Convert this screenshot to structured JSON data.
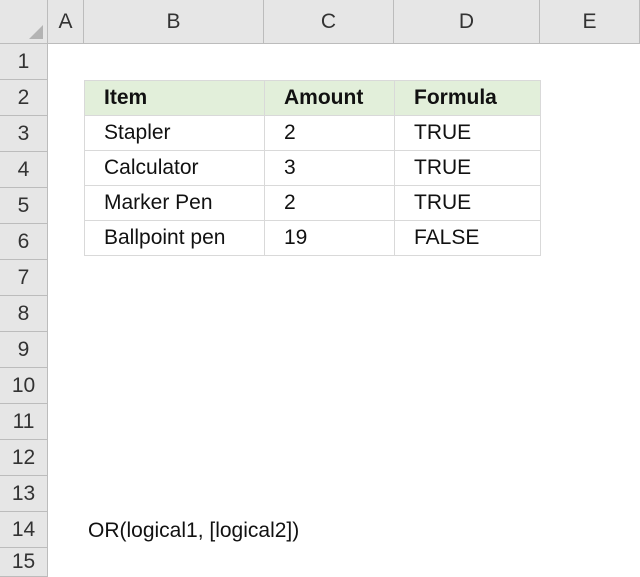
{
  "columns": [
    "A",
    "B",
    "C",
    "D",
    "E"
  ],
  "rows": [
    "1",
    "2",
    "3",
    "4",
    "5",
    "6",
    "7",
    "8",
    "9",
    "10",
    "11",
    "12",
    "13",
    "14",
    "15"
  ],
  "table": {
    "headers": [
      "Item",
      "Amount",
      "Formula"
    ],
    "rows": [
      [
        "Stapler",
        "2",
        "TRUE"
      ],
      [
        "Calculator",
        "3",
        "TRUE"
      ],
      [
        "Marker Pen",
        "2",
        "TRUE"
      ],
      [
        "Ballpoint pen",
        "19",
        "FALSE"
      ]
    ]
  },
  "note": "OR(logical1, [logical2])",
  "colors": {
    "header_fill": "#e2efda",
    "gridline": "#d9d9d9",
    "heading_bg": "#e6e6e6"
  }
}
